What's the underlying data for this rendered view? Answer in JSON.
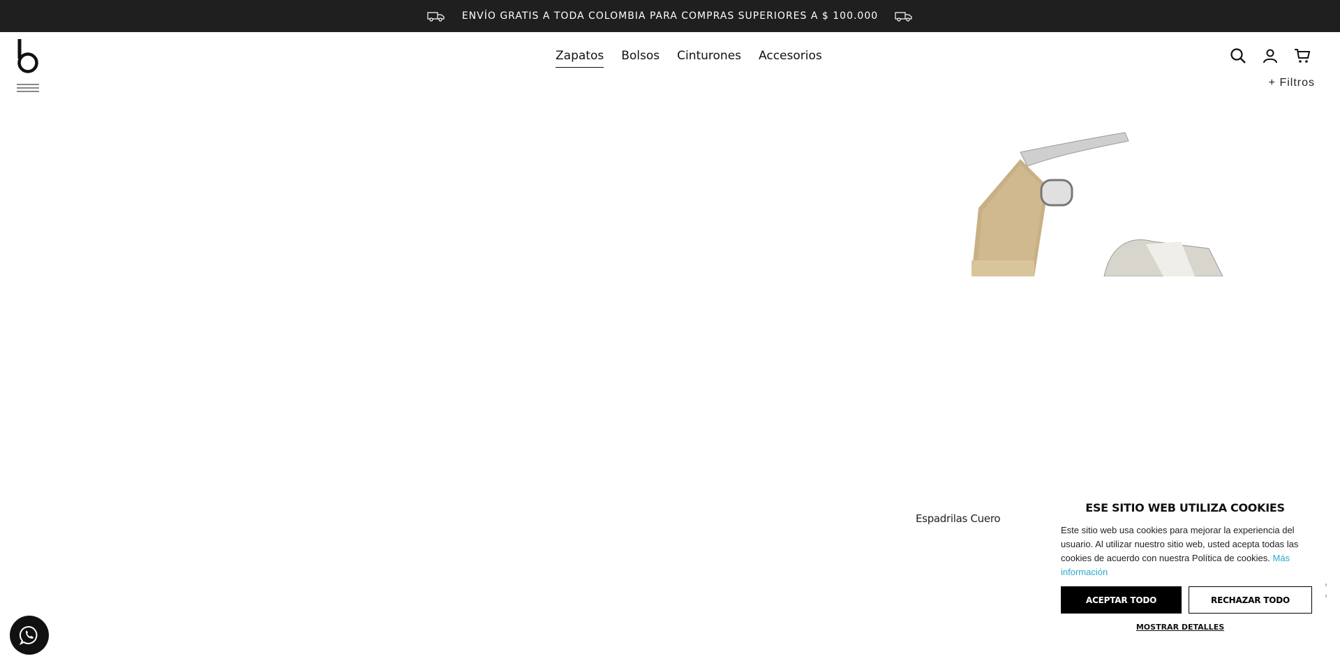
{
  "topbar": {
    "promo_text": "ENVÍO GRATIS A TODA COLOMBIA PARA COMPRAS SUPERIORES A $ 100.000",
    "icon_left": "truck-icon",
    "icon_right": "truck-icon"
  },
  "header": {
    "logo_icon": "logo-b-icon",
    "menu_icon": "hamburger-menu-icon",
    "nav": [
      {
        "label": "Zapatos",
        "active": true
      },
      {
        "label": "Bolsos",
        "active": false
      },
      {
        "label": "Cinturones",
        "active": false
      },
      {
        "label": "Accesorios",
        "active": false
      }
    ],
    "icons": [
      "search-icon",
      "user-icon",
      "cart-icon"
    ]
  },
  "filters_label": "+ Filtros",
  "product": {
    "name": "Espadrilas Cuero",
    "image_icon": "product-image-espadrille"
  },
  "cookie_banner": {
    "title": "ESE SITIO WEB UTILIZA COOKIES",
    "text": "Este sitio web usa cookies para mejorar la experiencia del usuario. Al utilizar nuestro sitio web, usted acepta todas las cookies de acuerdo con nuestra Política de cookies.",
    "link_text": "Más información",
    "accept_label": "ACEPTAR TODO",
    "reject_label": "RECHAZAR TODO",
    "details_label": "MOSTRAR DETALLES"
  },
  "whatsapp": {
    "icon": "whatsapp-icon"
  },
  "colors": {
    "topbar_bg": "#1f1f1f",
    "link": "#2aa9c9",
    "accent_dark": "#000000"
  }
}
